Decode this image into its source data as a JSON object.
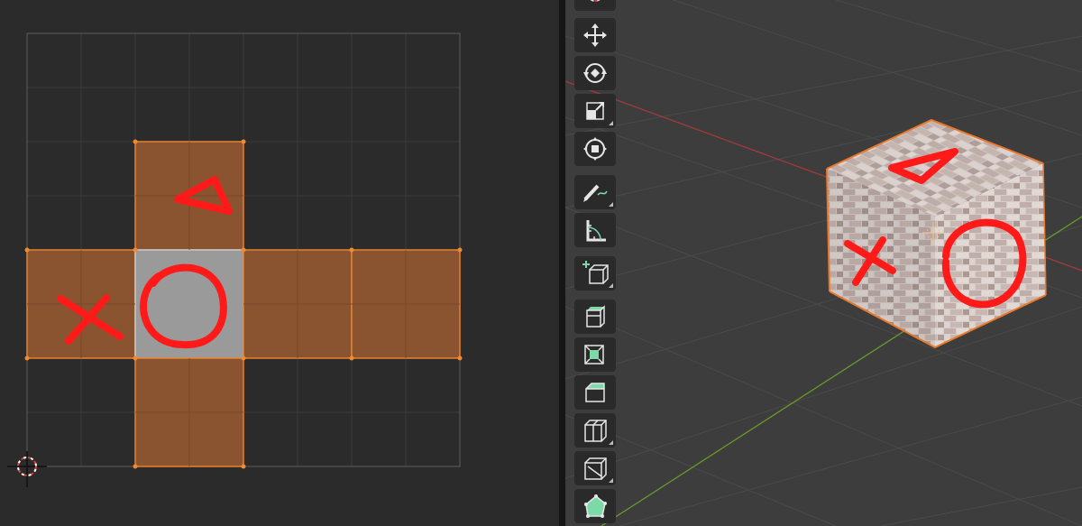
{
  "uv_editor": {
    "faces": [
      {
        "name": "top",
        "mark": "triangle"
      },
      {
        "name": "left",
        "mark": "cross"
      },
      {
        "name": "front",
        "mark": "circle",
        "selected": false
      },
      {
        "name": "right",
        "mark": "none"
      },
      {
        "name": "back",
        "mark": "none"
      },
      {
        "name": "bottom",
        "mark": "none"
      }
    ],
    "colors": {
      "face_fill": "#8a5431",
      "face_edge": "#e8822e",
      "selected_face": "#9a9a9a",
      "annotation": "#ff1a1a",
      "grid": "#3a3a3a",
      "background": "#2b2b2b"
    }
  },
  "toolbar": {
    "tools": [
      {
        "name": "cursor-tool",
        "icon": "cursor-icon"
      },
      {
        "name": "move-tool",
        "icon": "move-icon"
      },
      {
        "name": "rotate-tool",
        "icon": "rotate-icon"
      },
      {
        "name": "scale-tool",
        "icon": "scale-icon"
      },
      {
        "name": "transform-tool",
        "icon": "transform-icon"
      },
      {
        "name": "annotate-tool",
        "icon": "pencil-icon"
      },
      {
        "name": "measure-tool",
        "icon": "ruler-icon"
      },
      {
        "name": "add-cube-tool",
        "icon": "add-cube-icon"
      },
      {
        "name": "extrude-tool",
        "icon": "extrude-icon"
      },
      {
        "name": "inset-tool",
        "icon": "inset-icon"
      },
      {
        "name": "bevel-tool",
        "icon": "bevel-icon"
      },
      {
        "name": "loop-cut-tool",
        "icon": "loop-cut-icon"
      },
      {
        "name": "knife-tool",
        "icon": "knife-icon"
      },
      {
        "name": "poly-build-tool",
        "icon": "poly-build-icon"
      }
    ],
    "accent": "#7ed9a8"
  },
  "viewport": {
    "object": "cube",
    "texture": "brick",
    "marks": [
      "triangle",
      "cross",
      "circle"
    ],
    "axis_colors": {
      "x": "#a33a3a",
      "y": "#6a9a2a"
    }
  }
}
